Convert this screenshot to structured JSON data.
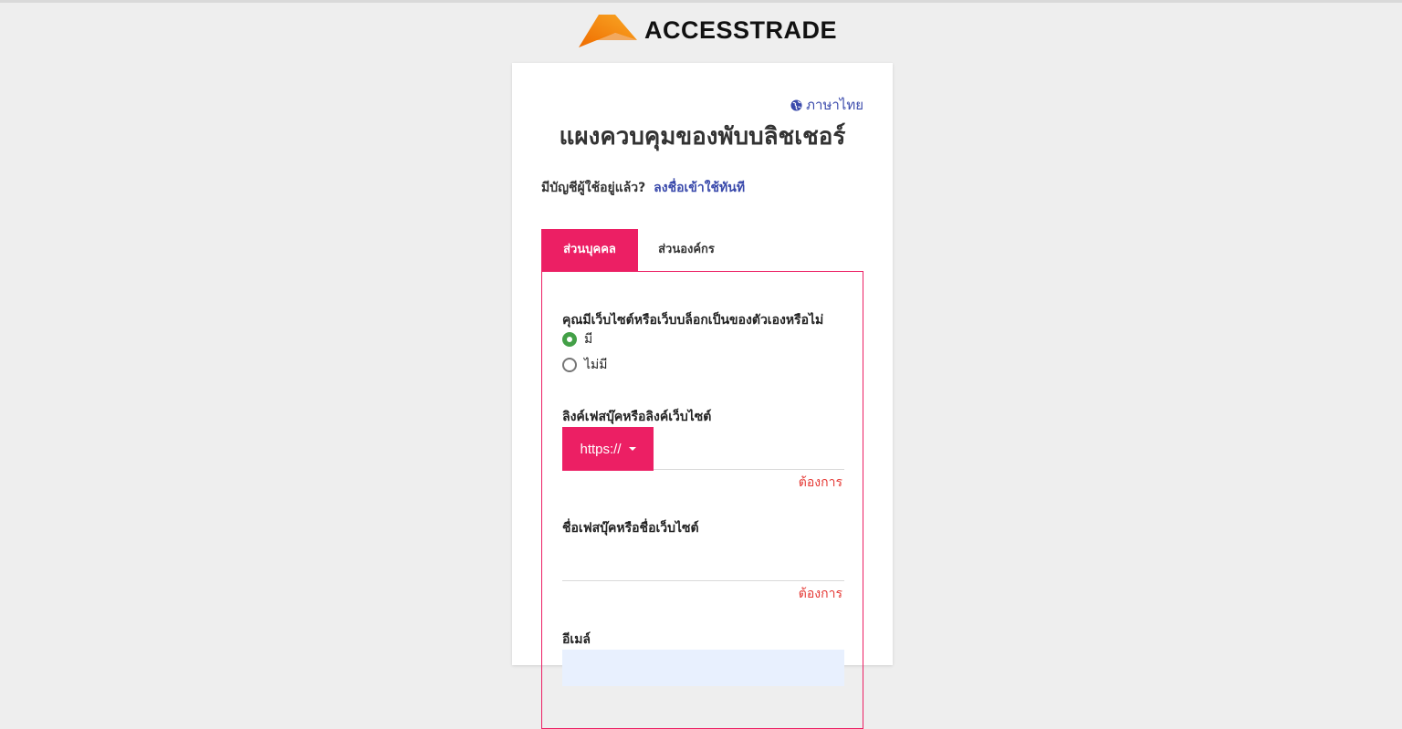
{
  "brand": {
    "name": "ACCESSTRADE",
    "logo_icon": "accesstrade-mountain-logo",
    "colors": [
      "#f9a825",
      "#ef6c00"
    ]
  },
  "header": {
    "language_icon": "globe-icon",
    "language_label": "ภาษาไทย",
    "title": "แผงควบคุมของพับบลิชเชอร์"
  },
  "signin": {
    "prompt": "มีบัญชีผู้ใช้อยู่แล้ว?",
    "link": "ลงชื่อเข้าใช้ทันที"
  },
  "tabs": [
    {
      "label": "ส่วนบุคคล",
      "active": true
    },
    {
      "label": "ส่วนองค์กร",
      "active": false
    }
  ],
  "form": {
    "has_website_question": "คุณมีเว็บไซต์หรือเว็บบล็อกเป็นของตัวเองหรือไม่",
    "options": [
      {
        "label": "มี",
        "selected": true
      },
      {
        "label": "ไม่มี",
        "selected": false
      }
    ],
    "link_label": "ลิงค์เฟสบุ๊คหรือลิงค์เว็บไซต์",
    "protocol": "https://",
    "link_value": "",
    "link_error": "ต้องการ",
    "name_label": "ชื่อเฟสบุ๊คหรือชื่อเว็บไซต์",
    "name_value": "",
    "name_error": "ต้องการ",
    "email_label": "อีเมล์",
    "email_value": ""
  },
  "colors": {
    "accent": "#ec1f64",
    "link": "#3949ab",
    "error": "#e53935",
    "radio_checked": "#43a047",
    "background": "#eeeeee"
  }
}
